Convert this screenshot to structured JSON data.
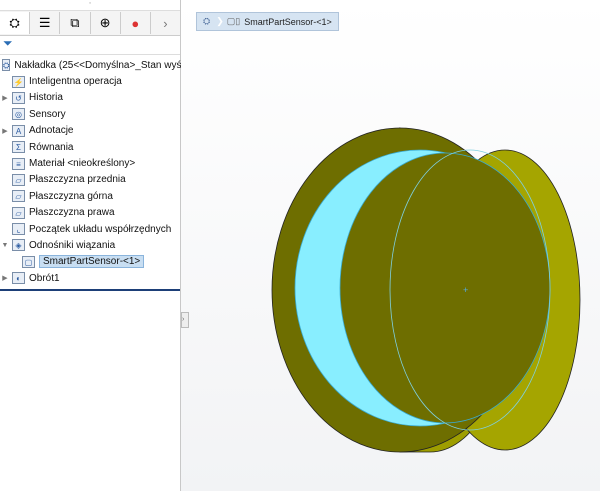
{
  "tree": {
    "root": "Nakładka  (25<<Domyślna>_Stan wyświe",
    "items": [
      {
        "label": "Inteligentna operacja",
        "expand": false,
        "icon": "smart-feature-icon"
      },
      {
        "label": "Historia",
        "expand": true,
        "icon": "history-icon"
      },
      {
        "label": "Sensory",
        "expand": false,
        "icon": "sensor-icon"
      },
      {
        "label": "Adnotacje",
        "expand": true,
        "icon": "annotation-icon"
      },
      {
        "label": "Równania",
        "expand": false,
        "icon": "equation-icon"
      },
      {
        "label": "Materiał <nieokreślony>",
        "expand": false,
        "icon": "material-icon"
      },
      {
        "label": "Płaszczyzna przednia",
        "expand": false,
        "icon": "plane-icon"
      },
      {
        "label": "Płaszczyzna górna",
        "expand": false,
        "icon": "plane-icon"
      },
      {
        "label": "Płaszczyzna prawa",
        "expand": false,
        "icon": "plane-icon"
      },
      {
        "label": "Początek układu współrzędnych",
        "expand": false,
        "icon": "origin-icon"
      },
      {
        "label": "Odnośniki wiązania",
        "expand": true,
        "icon": "mate-reference-icon"
      },
      {
        "label": "SmartPartSensor-<1>",
        "expand": false,
        "icon": "part-icon"
      },
      {
        "label": "Obrót1",
        "expand": true,
        "icon": "revolve-icon"
      }
    ]
  },
  "breadcrumb": {
    "label": "SmartPartSensor-<1>"
  },
  "colors": {
    "body": "#6b6b00",
    "rim": "#a3a300",
    "inner": "#8af0ff"
  }
}
